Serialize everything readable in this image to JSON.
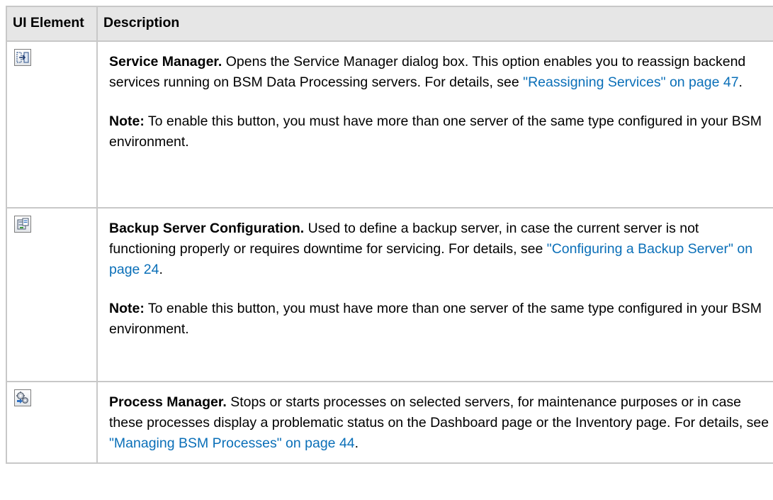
{
  "table": {
    "headers": {
      "ui_element": "UI Element",
      "description": "Description"
    },
    "rows": [
      {
        "icon": "service-manager-icon",
        "name": "Service Manager.",
        "text": " Opens the Service Manager dialog box. This option enables you to reassign backend services running on BSM Data Processing servers. For details, see ",
        "link": "\"Reassigning Services\" on page 47",
        "text_after": ".",
        "note_label": "Note:",
        "note_text": " To enable this button, you must have more than one server of the same type configured in your BSM environment."
      },
      {
        "icon": "backup-server-icon",
        "name": "Backup Server Configuration.",
        "text": " Used to define a backup server, in case the current server is not functioning properly or requires downtime for servicing. For details, see ",
        "link": "\"Configuring a Backup Server\" on page 24",
        "text_after": ".",
        "note_label": "Note:",
        "note_text": " To enable this button, you must have more than one server of the same type configured in your BSM environment."
      },
      {
        "icon": "process-manager-icon",
        "name": "Process Manager.",
        "text": " Stops or starts processes on selected servers, for maintenance purposes or in case these processes display a problematic status on the Dashboard page or the Inventory page. For details, see ",
        "link": "\"Managing BSM Processes\" on page 44",
        "text_after": "."
      }
    ]
  },
  "colors": {
    "link": "#0a6fb8",
    "header_bg": "#e6e6e6",
    "border": "#c8c8c8"
  }
}
